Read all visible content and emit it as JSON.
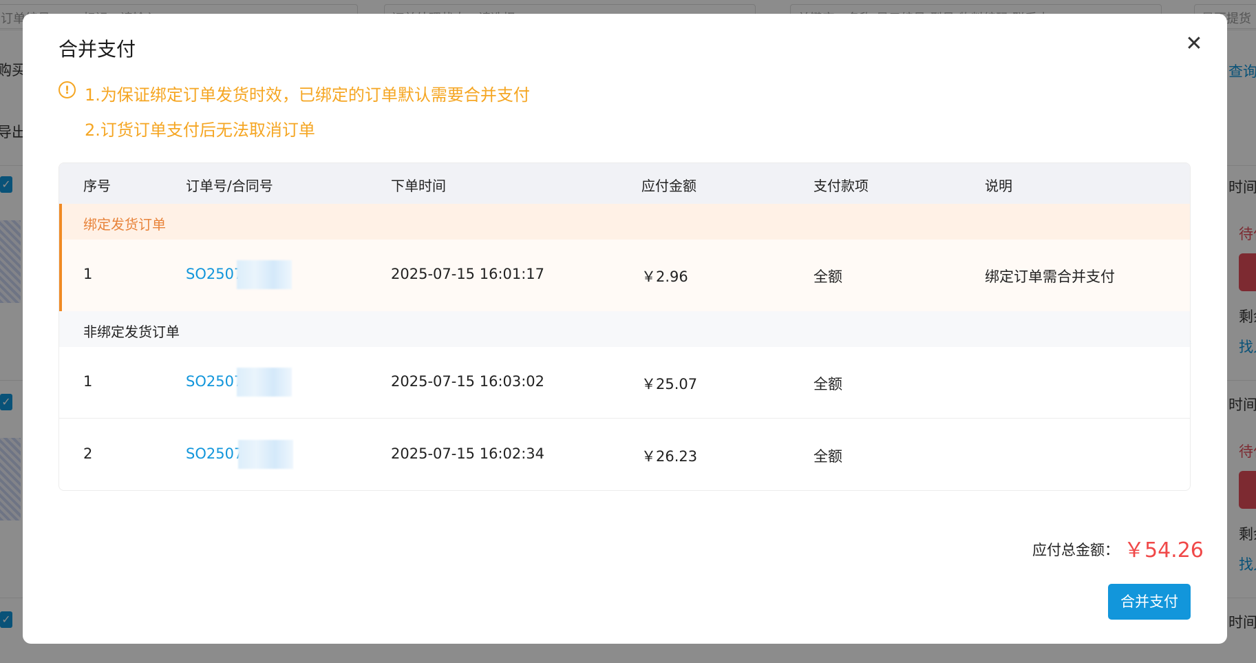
{
  "background": {
    "filters": [
      "订单编号/BOM标识：请输入",
      "订单处理状态：请选择",
      "关键字：名称/显示编号/型号/物料编码/联系人",
      "是否提货"
    ],
    "left_labels": [
      "购买",
      "导出"
    ],
    "query_button": "查询",
    "row_time_label": "时间",
    "row_status": "待付",
    "row_remaining": "剩余",
    "row_find": "找人"
  },
  "modal": {
    "title": "合并支付",
    "close_icon": "close-icon",
    "notice_icon": "warning-circle-icon",
    "notices": [
      "1.为保证绑定订单发货时效，已绑定的订单默认需要合并支付",
      "2.订货订单支付后无法取消订单"
    ],
    "table": {
      "headers": [
        "序号",
        "订单号/合同号",
        "下单时间",
        "应付金额",
        "支付款项",
        "说明"
      ],
      "bound_group": {
        "label": "绑定发货订单",
        "rows": [
          {
            "index": "1",
            "order_no": "SO2507",
            "time": "2025-07-15 16:01:17",
            "amount": "￥2.96",
            "payment": "全额",
            "note": "绑定订单需合并支付"
          }
        ]
      },
      "unbound_group": {
        "label": "非绑定发货订单",
        "rows": [
          {
            "index": "1",
            "order_no": "SO2507",
            "time": "2025-07-15 16:03:02",
            "amount": "￥25.07",
            "payment": "全额",
            "note": ""
          },
          {
            "index": "2",
            "order_no": "SO2507",
            "time": "2025-07-15 16:02:34",
            "amount": "￥26.23",
            "payment": "全额",
            "note": ""
          }
        ]
      }
    },
    "total_label": "应付总金额：",
    "total_value": "￥54.26",
    "pay_button": "合并支付"
  },
  "colors": {
    "primary": "#1296db",
    "warning": "#f5a623",
    "bound_accent": "#f08a24",
    "total_red": "#f04848"
  }
}
